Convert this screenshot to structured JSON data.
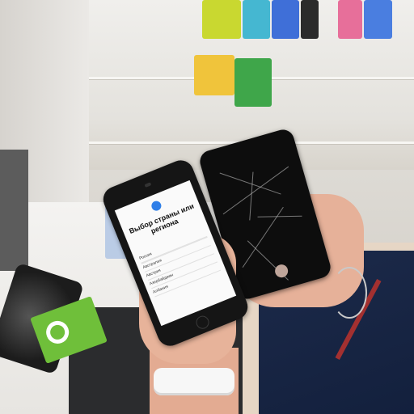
{
  "photo": {
    "phone_screen": {
      "heading": "Выбор страны или региона",
      "list_items": [
        "Россия",
        "",
        "Австралия",
        "Австрия",
        "Азербайджан",
        "Албания"
      ]
    }
  }
}
